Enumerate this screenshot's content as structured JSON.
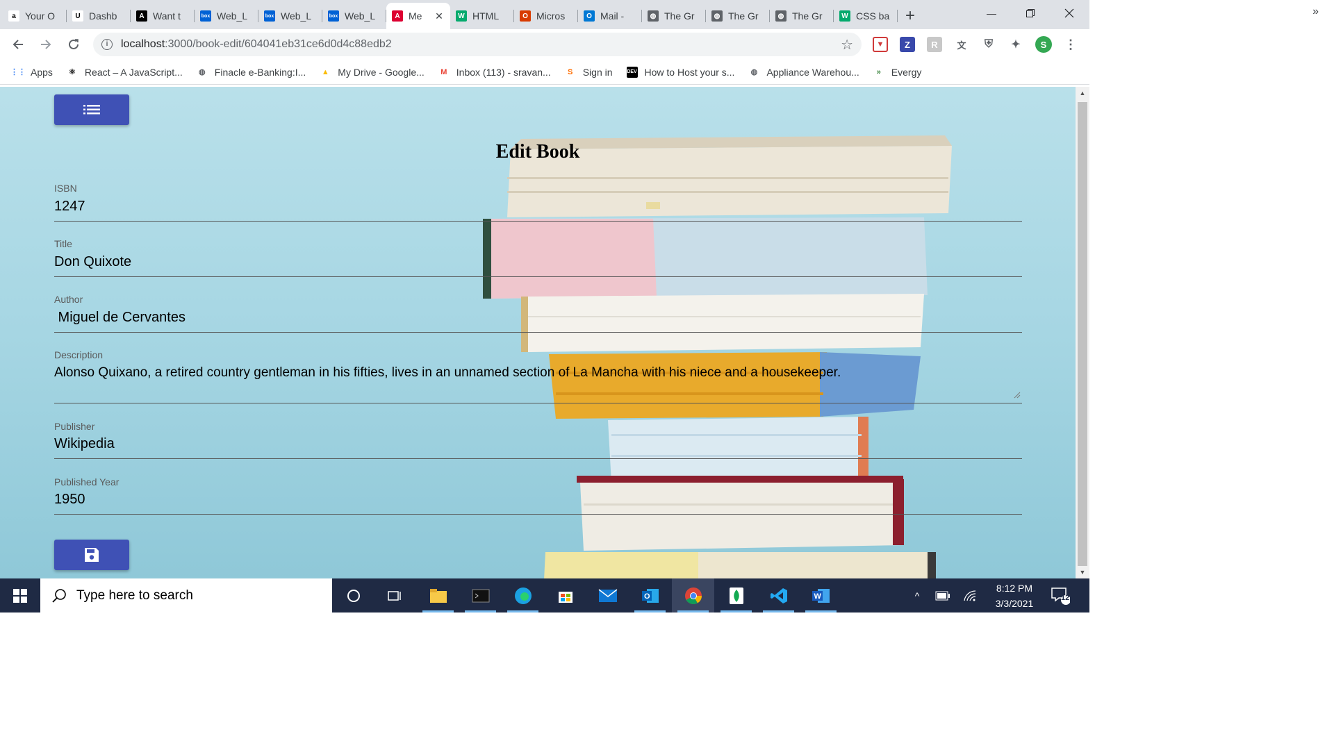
{
  "browser": {
    "tabs": [
      {
        "title": "Your O",
        "favicon": "amazon-icon",
        "color": "#ffffff",
        "glyph": "a"
      },
      {
        "title": "Dashb",
        "favicon": "umkc-icon",
        "color": "#ffffff",
        "glyph": "U"
      },
      {
        "title": "Want t",
        "favicon": "angular-dark-icon",
        "color": "#000000",
        "glyph": "A"
      },
      {
        "title": "Web_L",
        "favicon": "box-icon",
        "color": "#0061d5",
        "glyph": "box"
      },
      {
        "title": "Web_L",
        "favicon": "box-icon",
        "color": "#0061d5",
        "glyph": "box"
      },
      {
        "title": "Web_L",
        "favicon": "box-icon",
        "color": "#0061d5",
        "glyph": "box"
      },
      {
        "title": "Me",
        "favicon": "angular-icon",
        "color": "#dd0031",
        "glyph": "A",
        "active": true
      },
      {
        "title": "HTML",
        "favicon": "w3schools-icon",
        "color": "#04aa6d",
        "glyph": "W"
      },
      {
        "title": "Micros",
        "favicon": "office-icon",
        "color": "#d83b01",
        "glyph": "O"
      },
      {
        "title": "Mail -",
        "favicon": "outlook-icon",
        "color": "#0078d4",
        "glyph": "O"
      },
      {
        "title": "The Gr",
        "favicon": "globe-icon",
        "color": "#5f6368",
        "glyph": "◍"
      },
      {
        "title": "The Gr",
        "favicon": "globe-icon",
        "color": "#5f6368",
        "glyph": "◍"
      },
      {
        "title": "The Gr",
        "favicon": "globe-icon",
        "color": "#5f6368",
        "glyph": "◍"
      },
      {
        "title": "CSS ba",
        "favicon": "w3schools-icon",
        "color": "#04aa6d",
        "glyph": "W"
      }
    ],
    "url_host": "localhost",
    "url_path": ":3000/book-edit/604041eb31ce6d0d4c88edb2",
    "profile_initial": "S",
    "bookmarks": [
      {
        "label": "Apps",
        "icon": "apps-grid-icon"
      },
      {
        "label": "React – A JavaScript...",
        "icon": "react-icon"
      },
      {
        "label": "Finacle e-Banking:I...",
        "icon": "globe-icon"
      },
      {
        "label": "My Drive - Google...",
        "icon": "google-drive-icon"
      },
      {
        "label": "Inbox (113) - sravan...",
        "icon": "gmail-icon"
      },
      {
        "label": "Sign in",
        "icon": "sign-in-icon"
      },
      {
        "label": "How to Host your s...",
        "icon": "dev-icon"
      },
      {
        "label": "Appliance Warehou...",
        "icon": "globe-icon"
      },
      {
        "label": "Evergy",
        "icon": "evergy-icon"
      }
    ]
  },
  "page": {
    "title": "Edit Book",
    "fields": {
      "isbn": {
        "label": "ISBN",
        "value": "1247"
      },
      "title": {
        "label": "Title",
        "value": "Don Quixote"
      },
      "author": {
        "label": "Author",
        "value": " Miguel de Cervantes"
      },
      "description": {
        "label": "Description",
        "value": "Alonso Quixano, a retired country gentleman in his fifties, lives in an unnamed section of La Mancha with his niece and a housekeeper."
      },
      "publisher": {
        "label": "Publisher",
        "value": "Wikipedia"
      },
      "year": {
        "label": "Published Year",
        "value": "1950"
      }
    },
    "accent_color": "#3f51b5"
  },
  "taskbar": {
    "search_placeholder": "Type here to search",
    "time": "8:12 PM",
    "date": "3/3/2021",
    "notification_count": "12"
  }
}
